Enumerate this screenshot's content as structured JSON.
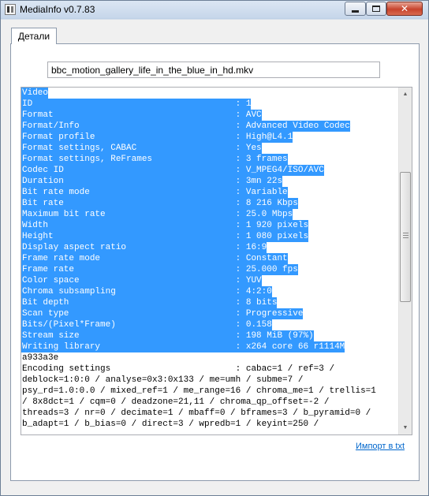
{
  "window": {
    "title": "MediaInfo v0.7.83"
  },
  "tabs": [
    {
      "label": "Детали"
    }
  ],
  "file": {
    "name": "bbc_motion_gallery_life_in_the_blue_in_hd.mkv"
  },
  "report": {
    "lines": [
      {
        "text": "Video",
        "selected": true
      },
      {
        "text": "ID                                       : 1",
        "selected": true
      },
      {
        "text": "Format                                   : AVC",
        "selected": true
      },
      {
        "text": "Format/Info                              : Advanced Video Codec",
        "selected": true
      },
      {
        "text": "Format profile                           : High@L4.1",
        "selected": true
      },
      {
        "text": "Format settings, CABAC                   : Yes",
        "selected": true
      },
      {
        "text": "Format settings, ReFrames                : 3 frames",
        "selected": true
      },
      {
        "text": "Codec ID                                 : V_MPEG4/ISO/AVC",
        "selected": true
      },
      {
        "text": "Duration                                 : 3mn 22s",
        "selected": true
      },
      {
        "text": "Bit rate mode                            : Variable",
        "selected": true
      },
      {
        "text": "Bit rate                                 : 8 216 Kbps",
        "selected": true
      },
      {
        "text": "Maximum bit rate                         : 25.0 Mbps",
        "selected": true
      },
      {
        "text": "Width                                    : 1 920 pixels",
        "selected": true
      },
      {
        "text": "Height                                   : 1 080 pixels",
        "selected": true
      },
      {
        "text": "Display aspect ratio                     : 16:9",
        "selected": true
      },
      {
        "text": "Frame rate mode                          : Constant",
        "selected": true
      },
      {
        "text": "Frame rate                               : 25.000 fps",
        "selected": true
      },
      {
        "text": "Color space                              : YUV",
        "selected": true
      },
      {
        "text": "Chroma subsampling                       : 4:2:0",
        "selected": true
      },
      {
        "text": "Bit depth                                : 8 bits",
        "selected": true
      },
      {
        "text": "Scan type                                : Progressive",
        "selected": true
      },
      {
        "text": "Bits/(Pixel*Frame)                       : 0.158",
        "selected": true
      },
      {
        "text": "Stream size                              : 198 MiB (97%)",
        "selected": true
      },
      {
        "text": "Writing library                          : x264 core 66 r1114M",
        "selected": true
      },
      {
        "text": "a933a3e",
        "selected": false
      },
      {
        "text": "Encoding settings                        : cabac=1 / ref=3 /",
        "selected": false
      },
      {
        "text": "deblock=1:0:0 / analyse=0x3:0x133 / me=umh / subme=7 /",
        "selected": false
      },
      {
        "text": "psy_rd=1.0:0.0 / mixed_ref=1 / me_range=16 / chroma_me=1 / trellis=1",
        "selected": false
      },
      {
        "text": "/ 8x8dct=1 / cqm=0 / deadzone=21,11 / chroma_qp_offset=-2 /",
        "selected": false
      },
      {
        "text": "threads=3 / nr=0 / decimate=1 / mbaff=0 / bframes=3 / b_pyramid=0 /",
        "selected": false
      },
      {
        "text": "b_adapt=1 / b_bias=0 / direct=3 / wpredb=1 / keyint=250 /",
        "selected": false
      }
    ]
  },
  "links": {
    "import": "Импорт в txt"
  },
  "colors": {
    "selection": "#3399ff",
    "link": "#0066cc"
  },
  "icons": [
    "app-icon",
    "minimize-icon",
    "maximize-icon",
    "close-icon",
    "scroll-up-arrow-icon",
    "scroll-down-arrow-icon"
  ]
}
